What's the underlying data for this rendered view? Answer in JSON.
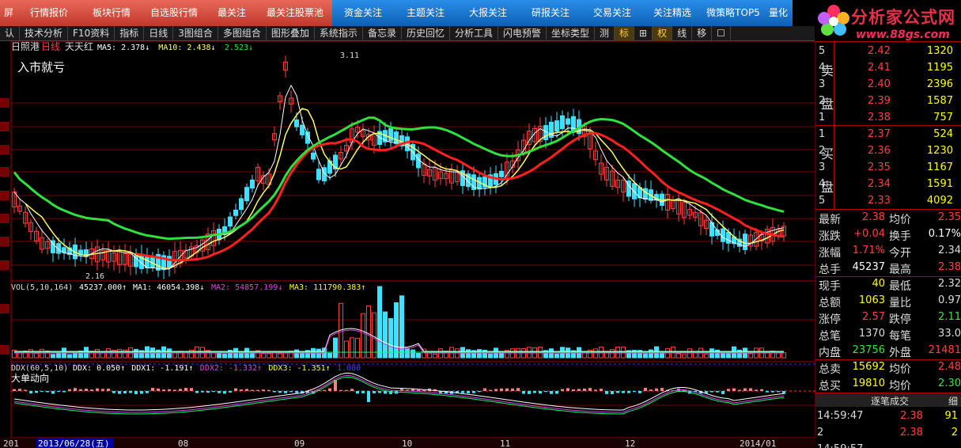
{
  "colors": {
    "up": "#ff4040",
    "down": "#40e0ff",
    "ma5": "#ffffff",
    "ma10": "#ffff66",
    "ma20": "#ff2020",
    "ma60": "#30e040",
    "purple": "#e040e0",
    "yellow": "#ffff00",
    "green": "#00ff66",
    "grid": "#7a0000"
  },
  "topnav": {
    "items": [
      {
        "label": "屏",
        "color": "red"
      },
      {
        "label": "行情报价",
        "color": "red"
      },
      {
        "label": "板块行情",
        "color": "red"
      },
      {
        "label": "自选股行情",
        "color": "red"
      },
      {
        "label": "最关注",
        "color": "red"
      },
      {
        "label": "最关注股票池",
        "color": "red"
      },
      {
        "label": "资金关注",
        "color": "blue"
      },
      {
        "label": "主题关注",
        "color": "blue"
      },
      {
        "label": "大报关注",
        "color": "blue"
      },
      {
        "label": "研报关注",
        "color": "blue"
      },
      {
        "label": "交易关注",
        "color": "blue"
      },
      {
        "label": "关注精选",
        "color": "blue"
      },
      {
        "label": "微策略TOP5",
        "color": "blue"
      },
      {
        "label": "量化",
        "color": "blue"
      }
    ]
  },
  "logo": {
    "title": "分析家公式网",
    "url": "www.88gs.com",
    "icon": "flower-logo-icon"
  },
  "toolbar": {
    "items": [
      "认",
      "技术分析",
      "F10资料",
      "指标",
      "日线",
      "3图组合",
      "多图组合",
      "图形叠加",
      "系统指示",
      "备忘录",
      "历史回忆",
      "分析工具",
      "闪电预警",
      "坐标类型",
      "测",
      "标",
      "⊞",
      "权",
      "线",
      "移",
      "☐"
    ]
  },
  "chart": {
    "stock": {
      "name": "日照港",
      "period": "日线",
      "formula": "天天红"
    },
    "ma_text": [
      {
        "t": "MA5: 2.378↓",
        "c": "#ffffff"
      },
      {
        "t": "MA10: 2.438↓",
        "c": "#ffff66"
      },
      {
        "t": "2.523↓",
        "c": "#30e040"
      }
    ],
    "note": "入市就亏",
    "high_label": "3.11",
    "low_label": "2.16",
    "vol_title": "VOL(5,10,164)",
    "vol_text": [
      {
        "t": "45237.000↑",
        "c": "#ffffff"
      },
      {
        "t": "MA1: 46054.398↓",
        "c": "#ffffff"
      },
      {
        "t": "MA2: 54857.199↓",
        "c": "#e040e0"
      },
      {
        "t": "MA3: 111790.383↑",
        "c": "#ffff00"
      }
    ],
    "ddx_title": "DDX(60,5,10)",
    "ddx_text": [
      {
        "t": "DDX: 0.050↑",
        "c": "#ffffff"
      },
      {
        "t": "DDX1: -1.191↑",
        "c": "#ffffff"
      },
      {
        "t": "DDX2: -1.332↑",
        "c": "#e040e0"
      },
      {
        "t": "DDX3: -1.351↑",
        "c": "#ffff00"
      },
      {
        "t": "1.000",
        "c": "#4040ff"
      }
    ],
    "ddx_note": "大单动向",
    "bottom_labels": [
      {
        "t": "201"
      },
      {
        "t": "2013/06/28(五)",
        "hl": true
      },
      {
        "t": "08"
      },
      {
        "t": "09"
      },
      {
        "t": "10"
      },
      {
        "t": "11"
      },
      {
        "t": "12"
      },
      {
        "t": "2014/01"
      }
    ]
  },
  "orderbook": {
    "sell_label": [
      "卖",
      "盘"
    ],
    "buy_label": [
      "买",
      "盘"
    ],
    "sell": [
      {
        "n": "5",
        "p": "2.42",
        "v": "1320"
      },
      {
        "n": "4",
        "p": "2.41",
        "v": "1195"
      },
      {
        "n": "3",
        "p": "2.40",
        "v": "2396"
      },
      {
        "n": "2",
        "p": "2.39",
        "v": "1587"
      },
      {
        "n": "1",
        "p": "2.38",
        "v": "757"
      }
    ],
    "buy": [
      {
        "n": "1",
        "p": "2.37",
        "v": "524"
      },
      {
        "n": "2",
        "p": "2.36",
        "v": "1230"
      },
      {
        "n": "3",
        "p": "2.35",
        "v": "1167"
      },
      {
        "n": "4",
        "p": "2.34",
        "v": "1591"
      },
      {
        "n": "5",
        "p": "2.33",
        "v": "4092"
      }
    ]
  },
  "stats": [
    {
      "l": "最新",
      "v": "2.38",
      "vc": "#ff4040",
      "l2": "均价",
      "v2": "2.35",
      "v2c": "#ff4040"
    },
    {
      "l": "涨跌",
      "v": "+0.04",
      "vc": "#ff4040",
      "l2": "换手",
      "v2": "0.17%",
      "v2c": "#ffffff"
    },
    {
      "l": "涨幅",
      "v": "1.71%",
      "vc": "#ff4040",
      "l2": "今开",
      "v2": "2.34",
      "v2c": "#dddddd"
    },
    {
      "l": "总手",
      "v": "45237",
      "vc": "#ffffff",
      "l2": "最高",
      "v2": "2.38",
      "v2c": "#ff4040"
    },
    {
      "l": "现手",
      "v": "40",
      "vc": "#ffff00",
      "l2": "最低",
      "v2": "2.32",
      "v2c": "#dddddd"
    },
    {
      "l": "总额",
      "v": "1063",
      "vc": "#ffff00",
      "l2": "量比",
      "v2": "0.97",
      "v2c": "#dddddd"
    },
    {
      "l": "涨停",
      "v": "2.57",
      "vc": "#ff4040",
      "l2": "跌停",
      "v2": "2.11",
      "v2c": "#40e040"
    },
    {
      "l": "总笔",
      "v": "1370",
      "vc": "#dddddd",
      "l2": "每笔",
      "v2": "33.0",
      "v2c": "#dddddd"
    },
    {
      "l": "内盘",
      "v": "23756",
      "vc": "#40e040",
      "l2": "外盘",
      "v2": "21481",
      "v2c": "#ff4040"
    },
    {
      "l": "总卖",
      "v": "15692",
      "vc": "#ffff00",
      "l2": "均价",
      "v2": "2.48",
      "v2c": "#ff4040"
    },
    {
      "l": "总买",
      "v": "19810",
      "vc": "#ffff00",
      "l2": "均价",
      "v2": "2.30",
      "v2c": "#40e040"
    }
  ],
  "trades": {
    "title": "逐笔成交",
    "close_label": "细",
    "rows": [
      {
        "t": "14:59:47",
        "p": "2.38",
        "v": "91"
      },
      {
        "t": "2",
        "p": "2.38",
        "v": "2"
      },
      {
        "t": "14:59:57",
        "p": "",
        "v": ""
      }
    ]
  }
}
